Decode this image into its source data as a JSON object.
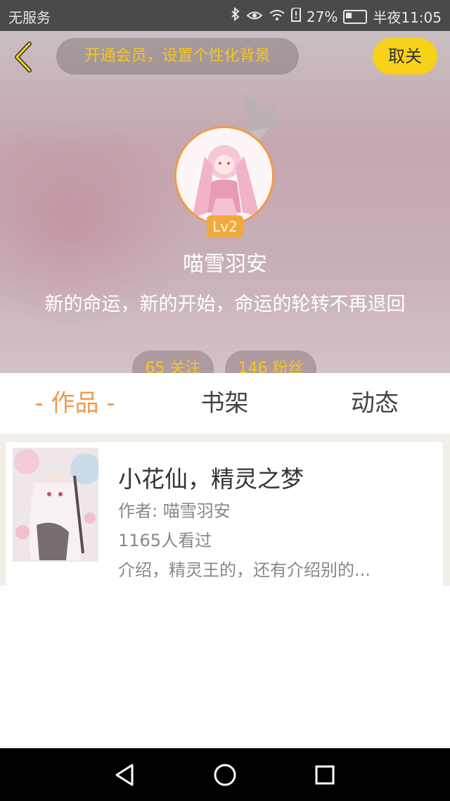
{
  "status_bar": {
    "carrier": "无服务",
    "battery": "27%",
    "time": "半夜11:05",
    "icons": [
      "bluetooth-icon",
      "eye-icon",
      "wifi-icon",
      "sim-icon",
      "battery-icon"
    ]
  },
  "header": {
    "back_icon": "chevron-left-icon",
    "vip_banner": "开通会员，设置个性化背景",
    "unfollow_label": "取关"
  },
  "profile": {
    "level": "Lv2",
    "username": "喵雪羽安",
    "bio": "新的命运，新的开始，命运的轮转不再退回",
    "following": "65 关注",
    "fans": "146 粉丝"
  },
  "tabs": [
    {
      "label": "- 作品 -",
      "active": true
    },
    {
      "label": "书架",
      "active": false
    },
    {
      "label": "动态",
      "active": false
    }
  ],
  "works": [
    {
      "title": "小花仙，精灵之梦",
      "author": "作者: 喵雪羽安",
      "views": "1165人看过",
      "intro": "介绍，精灵王的，还有介绍别的..."
    }
  ],
  "colors": {
    "accent": "#ef9a4f",
    "vip_text": "#f6c623",
    "unfollow_bg": "#f7d11a",
    "level_badge": "#f2a93b"
  },
  "navbar": {
    "icons": [
      "nav-back-icon",
      "nav-home-icon",
      "nav-recent-icon"
    ]
  }
}
